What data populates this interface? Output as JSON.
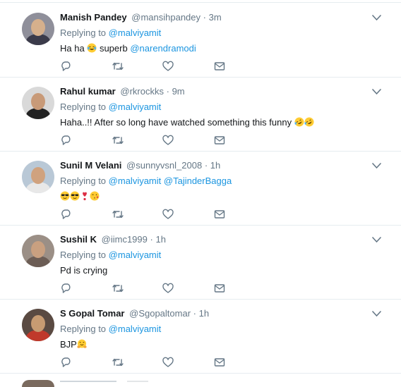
{
  "tweets": [
    {
      "name": "Manish Pandey",
      "handle": "@mansihpandey",
      "separator": "·",
      "time": "3m",
      "replying_prefix": "Replying to",
      "replying_to": "@malviyamit",
      "text_parts": [
        "Ha ha",
        "superb",
        "@narendramodi"
      ],
      "emojis": [
        "face-with-tears-of-joy"
      ],
      "avatar": {
        "bg": "#8f8f9a",
        "face": "#d6b08c",
        "body": "#3b3b4a"
      }
    },
    {
      "name": "Rahul kumar",
      "handle": "@rkrockks",
      "separator": "·",
      "time": "9m",
      "replying_prefix": "Replying to",
      "replying_to": "@malviyamit",
      "text": "Haha..!! After so long have watched something this funny",
      "emojis": [
        "rolling-on-floor-laughing",
        "rolling-on-floor-laughing"
      ],
      "avatar": {
        "bg": "#d9d9d9",
        "face": "#c89a78",
        "body": "#222222"
      }
    },
    {
      "name": "Sunil M Velani",
      "handle": "@sunnyvsnl_2008",
      "separator": "·",
      "time": "1h",
      "replying_prefix": "Replying to",
      "replying_to": "@malviyamit",
      "replying_to_2": "@TajinderBagga",
      "emojis": [
        "smiling-face-with-sunglasses",
        "smiling-face-with-sunglasses",
        "heavy-heart-exclamation",
        "face-blowing-a-kiss"
      ],
      "avatar": {
        "bg": "#b9c8d6",
        "face": "#d0a27e",
        "body": "#e8e8e8"
      }
    },
    {
      "name": "Sushil K",
      "handle": "@iimc1999",
      "separator": "·",
      "time": "1h",
      "replying_prefix": "Replying to",
      "replying_to": "@malviyamit",
      "text": "Pd is crying",
      "avatar": {
        "bg": "#9b8f86",
        "face": "#c9a080",
        "body": "#6c5d55"
      }
    },
    {
      "name": "S Gopal Tomar",
      "handle": "@Sgopaltomar",
      "separator": "·",
      "time": "1h",
      "replying_prefix": "Replying to",
      "replying_to": "@malviyamit",
      "text": "BJP",
      "emojis": [
        "hugging-face"
      ],
      "avatar": {
        "bg": "#5a4a42",
        "face": "#c79b72",
        "body": "#c0392b"
      }
    }
  ],
  "actions": [
    "reply-icon",
    "retweet-icon",
    "like-icon",
    "direct-message-icon"
  ],
  "colors": {
    "secondary": "#657786",
    "link": "#1b95e0",
    "divider": "#e6ecf0",
    "icon": "#657786"
  }
}
